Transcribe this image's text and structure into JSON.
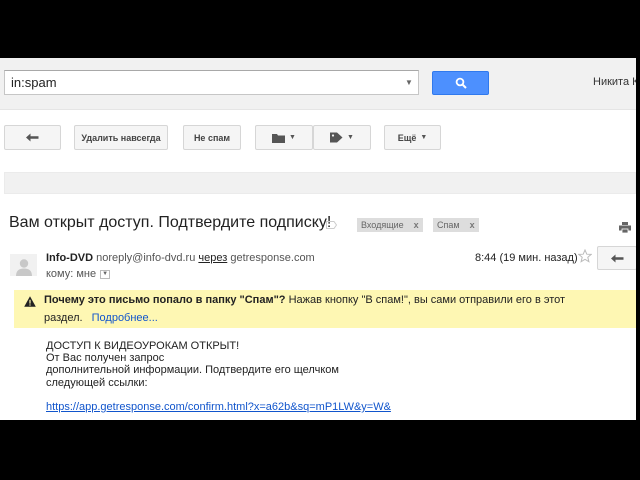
{
  "header": {
    "search_value": "in:spam",
    "user_name": "Никита К"
  },
  "toolbar": {
    "delete_forever": "Удалить навсегда",
    "not_spam": "Не спам",
    "more": "Ещё"
  },
  "message": {
    "subject": "Вам открыт доступ. Подтвердите подписку!",
    "labels": [
      {
        "text": "Входящие",
        "close": "x"
      },
      {
        "text": "Спам",
        "close": "x"
      }
    ],
    "sender_name": "Info-DVD",
    "sender_email": "noreply@info-dvd.ru",
    "via_label": "через",
    "via_domain": "getresponse.com",
    "to_label": "кому: мне",
    "time": "8:44 (19 мин. назад)"
  },
  "spam_warning": {
    "question": "Почему это письмо попало в папку \"Спам\"?",
    "explanation": "Нажав кнопку \"В спам!\", вы сами отправили его в этот",
    "line2": "раздел.",
    "more_link": "Подробнее..."
  },
  "body": {
    "lines": [
      "ДОСТУП К ВИДЕОУРОКАМ ОТКРЫТ!",
      "От Вас получен запрос",
      "дополнительной информации. Подтвердите его щелчком",
      "следующей ссылки:"
    ],
    "link": "https://app.getresponse.com/confirm.html?x=a62b&sq=mP1LW&y=W&"
  },
  "colors": {
    "search_button": "#4d90fe",
    "banner": "#fef7b3",
    "link": "#1155cc"
  }
}
